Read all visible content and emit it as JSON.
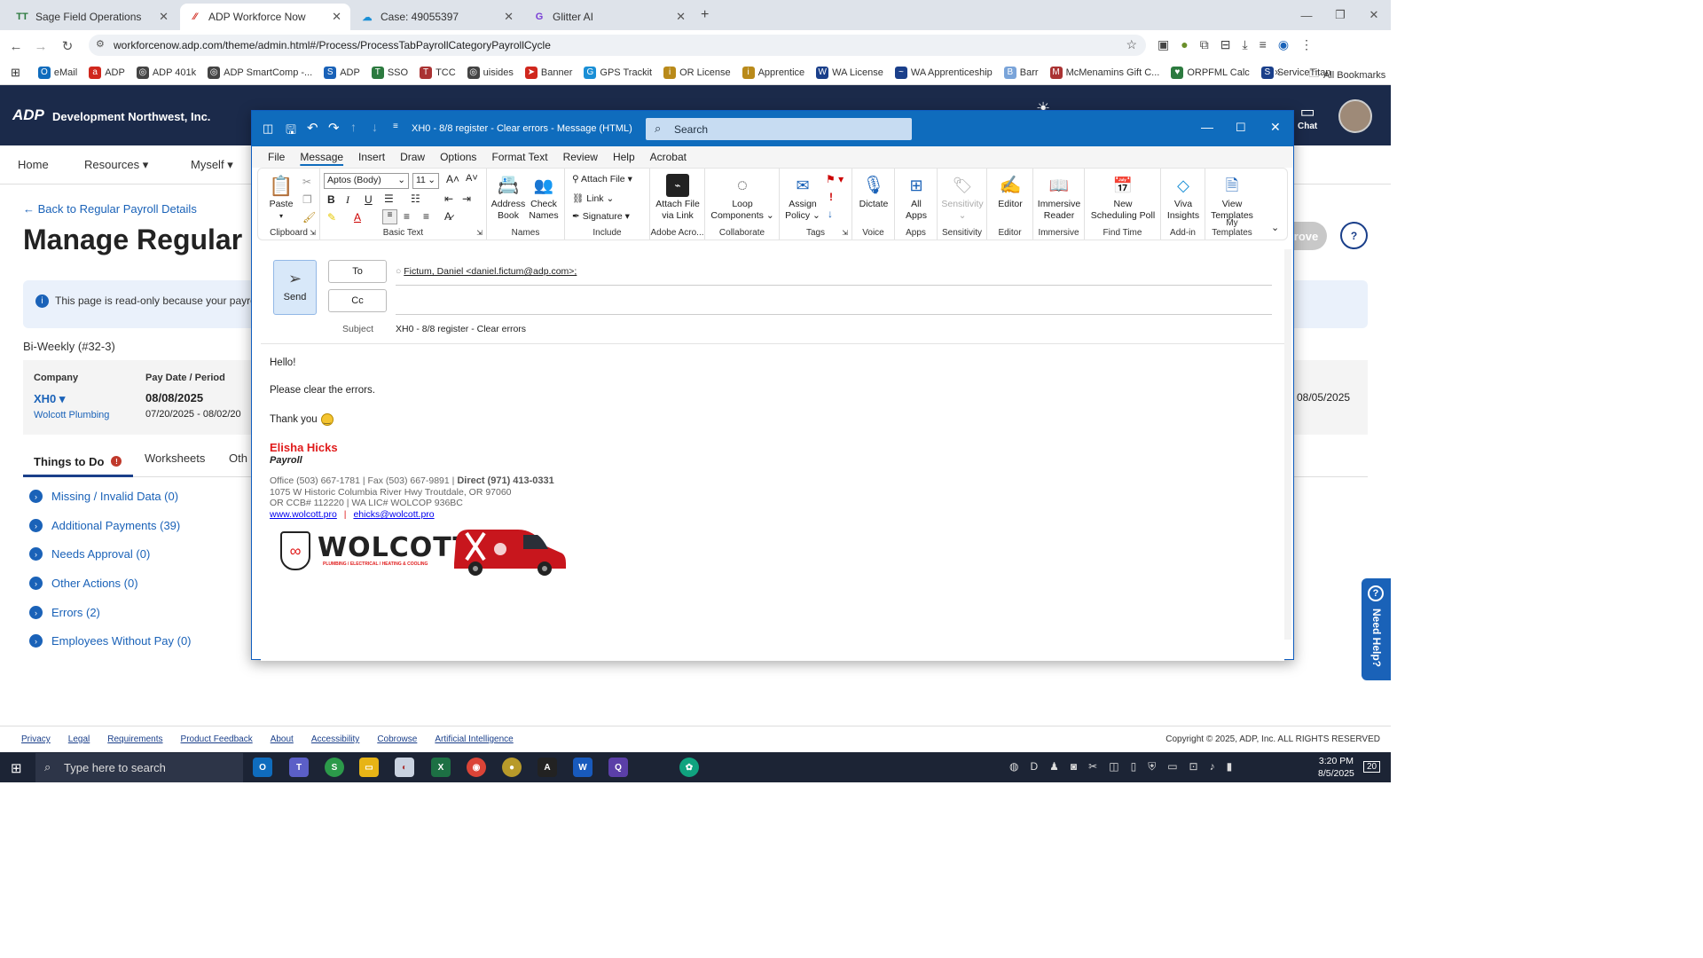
{
  "browser": {
    "tabs": [
      {
        "title": "Sage Field Operations"
      },
      {
        "title": "ADP Workforce Now"
      },
      {
        "title": "Case: 49055397"
      },
      {
        "title": "Glitter AI"
      }
    ],
    "url": "workforcenow.adp.com/theme/admin.html#/Process/ProcessTabPayrollCategoryPayrollCycle",
    "bookmarks": [
      "eMail",
      "ADP",
      "ADP 401k",
      "ADP SmartComp -...",
      "ADP",
      "SSO",
      "TCC",
      "uisides",
      "Banner",
      "GPS Trackit",
      "OR License",
      "Apprentice",
      "WA License",
      "WA Apprenticeship",
      "Barr",
      "McMenamins Gift C...",
      "ORPFML Calc",
      "ServiceTitan"
    ],
    "all_bookmarks": "All Bookmarks"
  },
  "adp": {
    "company_name": "Development Northwest, Inc.",
    "chat_label": "Chat",
    "nav": [
      "Home",
      "Resources",
      "Myself"
    ],
    "back_link": "Back to Regular Payroll Details",
    "page_title": "Manage Regular",
    "info_text": "This page is read-only because your payrol",
    "approve_label": "rove",
    "cycle": "Bi-Weekly (#32-3)",
    "company_label": "Company",
    "company_code": "XH0",
    "company_sub": "Wolcott Plumbing",
    "paydate_label": "Pay Date / Period",
    "paydate": "08/08/2025",
    "period": "07/20/2025 - 08/02/20",
    "right_date": "08/05/2025",
    "tabs": [
      "Things to Do",
      "Worksheets",
      "Oth"
    ],
    "todos": [
      "Missing / Invalid Data (0)",
      "Additional Payments (39)",
      "Needs Approval (0)",
      "Other Actions (0)",
      "Errors (2)",
      "Employees Without Pay (0)"
    ],
    "need_help": "Need Help?",
    "footer_links": [
      "Privacy",
      "Legal",
      "Requirements",
      "Product Feedback",
      "About",
      "Accessibility",
      "Cobrowse",
      "Artificial Intelligence"
    ],
    "copyright": "Copyright © 2025, ADP, Inc. ALL RIGHTS RESERVED"
  },
  "outlook": {
    "window_title": "XH0 - 8/8 register - Clear errors  -  Message (HTML)",
    "search_placeholder": "Search",
    "menu": [
      "File",
      "Message",
      "Insert",
      "Draw",
      "Options",
      "Format Text",
      "Review",
      "Help",
      "Acrobat"
    ],
    "ribbon": {
      "paste": "Paste",
      "clipboard": "Clipboard",
      "font": "Aptos (Body)",
      "size": "11",
      "basic_text": "Basic Text",
      "address_book": [
        "Address",
        "Book"
      ],
      "check_names": [
        "Check",
        "Names"
      ],
      "names": "Names",
      "attach_file": "Attach File",
      "link": "Link",
      "signature": "Signature",
      "include": "Include",
      "attach_via_link": [
        "Attach File",
        "via Link"
      ],
      "adobe": "Adobe Acro...",
      "loop": [
        "Loop",
        "Components"
      ],
      "collaborate": "Collaborate",
      "assign_policy": [
        "Assign",
        "Policy"
      ],
      "tags": "Tags",
      "dictate": "Dictate",
      "voice": "Voice",
      "all_apps": [
        "All",
        "Apps"
      ],
      "apps": "Apps",
      "sensitivity": "Sensitivity",
      "sensitivity_grp": "Sensitivity",
      "editor": "Editor",
      "editor_grp": "Editor",
      "immersive_reader": [
        "Immersive",
        "Reader"
      ],
      "immersive": "Immersive",
      "scheduling_poll": [
        "New",
        "Scheduling Poll"
      ],
      "find_time": "Find Time",
      "viva": [
        "Viva",
        "Insights"
      ],
      "addin": "Add-in",
      "view_templates": [
        "View",
        "Templates"
      ],
      "my_templates": "My Templates"
    },
    "send": "Send",
    "to_label": "To",
    "cc_label": "Cc",
    "to_value": "Fictum, Daniel <daniel.fictum@adp.com>;",
    "subject_label": "Subject",
    "subject_value": "XH0 - 8/8 register - Clear errors",
    "body": [
      "Hello!",
      "Please clear the errors.",
      "Thank you"
    ],
    "signature": {
      "name": "Elisha Hicks",
      "title": "Payroll",
      "office_line": "Office (503) 667-1781 | Fax (503) 667-9891 | ",
      "direct": "Direct (971) 413-0331",
      "address": "1075 W Historic Columbia River Hwy Troutdale, OR 97060",
      "license": "OR CCB# 112220 | WA LIC# WOLCOP 936BC",
      "website": "www.wolcott.pro",
      "email": "ehicks@wolcott.pro",
      "logo_text": "WOLCOTT",
      "logo_sub": "PLUMBING / ELECTRICAL / HEATING & COOLING"
    }
  },
  "taskbar": {
    "search_placeholder": "Type here to search",
    "time": "3:20 PM",
    "date": "8/5/2025",
    "notif": "20"
  }
}
